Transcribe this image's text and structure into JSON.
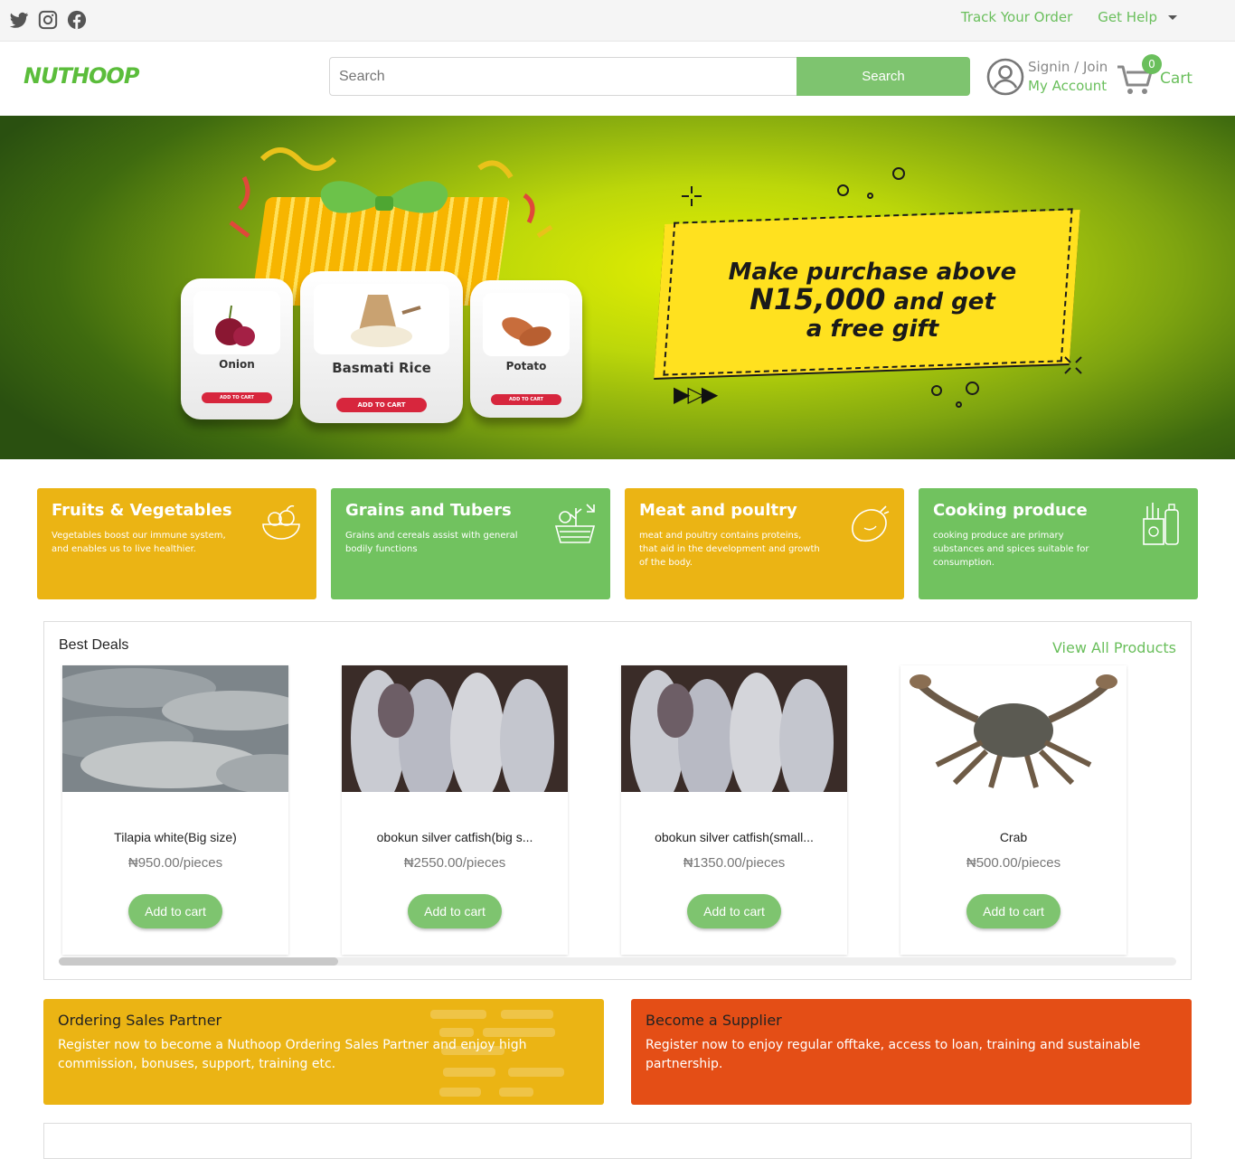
{
  "topbar": {
    "social_icons": [
      "twitter-icon",
      "instagram-icon",
      "facebook-icon"
    ],
    "track_order": "Track Your Order",
    "get_help": "Get Help"
  },
  "header": {
    "logo_text": "NUTHOOP",
    "search_placeholder": "Search",
    "search_button": "Search",
    "signin_join": "Signin / Join",
    "my_account": "My Account",
    "cart_count": "0",
    "cart_label": "Cart"
  },
  "hero": {
    "headline_1": "Make purchase above",
    "headline_2": "N15,000",
    "headline_3": "and get",
    "headline_4": "a free gift",
    "products": [
      {
        "name": "Onion",
        "button": "ADD TO CART"
      },
      {
        "name": "Basmati Rice",
        "button": "ADD TO CART"
      },
      {
        "name": "Potato",
        "button": "ADD TO CART"
      }
    ]
  },
  "categories": [
    {
      "title": "Fruits & Vegetables",
      "desc": "Vegetables boost our immune system, and enables us to live healthier.",
      "icon": "fruit-bowl-icon",
      "color": "#ebb414"
    },
    {
      "title": "Grains and Tubers",
      "desc": "Grains and cereals assist with general bodily functions",
      "icon": "grain-basket-icon",
      "color": "#71c25f"
    },
    {
      "title": "Meat and poultry",
      "desc": "meat and poultry contains proteins, that aid in the development and growth of the body.",
      "icon": "chicken-icon",
      "color": "#ebb414"
    },
    {
      "title": "Cooking produce",
      "desc": "cooking produce are primary substances and spices suitable for consumption.",
      "icon": "groceries-icon",
      "color": "#71c25f"
    }
  ],
  "deals": {
    "title": "Best Deals",
    "view_all": "View All Products",
    "items": [
      {
        "name": "Tilapia white(Big size)",
        "price": "₦950.00/pieces",
        "button": "Add to cart"
      },
      {
        "name": "obokun silver catfish(big s...",
        "price": "₦2550.00/pieces",
        "button": "Add to cart"
      },
      {
        "name": "obokun silver catfish(small...",
        "price": "₦1350.00/pieces",
        "button": "Add to cart"
      },
      {
        "name": "Crab",
        "price": "₦500.00/pieces",
        "button": "Add to cart"
      }
    ]
  },
  "partners": {
    "sales": {
      "title": "Ordering Sales Partner",
      "desc": "Register now to become a Nuthoop Ordering Sales Partner and enjoy high commission, bonuses, support, training etc."
    },
    "supplier": {
      "title": "Become a Supplier",
      "desc": "Register now to enjoy regular offtake, access to loan, training and sustainable partnership."
    }
  }
}
